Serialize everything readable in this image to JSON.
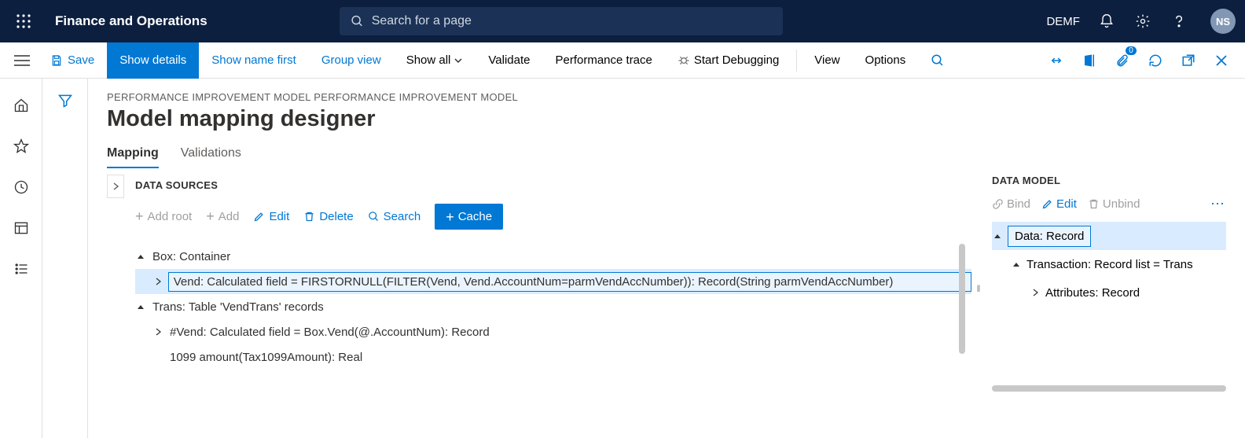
{
  "header": {
    "app_title": "Finance and Operations",
    "search_placeholder": "Search for a page",
    "company": "DEMF",
    "avatar": "NS"
  },
  "action_bar": {
    "save": "Save",
    "show_details": "Show details",
    "show_name_first": "Show name first",
    "group_view": "Group view",
    "show_all": "Show all",
    "validate": "Validate",
    "perf_trace": "Performance trace",
    "start_debug": "Start Debugging",
    "view": "View",
    "options": "Options",
    "badge_count": "0"
  },
  "page": {
    "breadcrumb": "PERFORMANCE IMPROVEMENT MODEL PERFORMANCE IMPROVEMENT MODEL",
    "title": "Model mapping designer",
    "tabs": {
      "mapping": "Mapping",
      "validations": "Validations"
    }
  },
  "data_sources": {
    "title": "DATA SOURCES",
    "toolbar": {
      "add_root": "Add root",
      "add": "Add",
      "edit": "Edit",
      "delete": "Delete",
      "search": "Search",
      "cache": "Cache"
    },
    "tree": {
      "r0": "Box: Container",
      "r1": "Vend: Calculated field = FIRSTORNULL(FILTER(Vend, Vend.AccountNum=parmVendAccNumber)): Record(String parmVendAccNumber)",
      "r2": "Trans: Table 'VendTrans' records",
      "r3": "#Vend: Calculated field = Box.Vend(@.AccountNum): Record",
      "r4": "1099 amount(Tax1099Amount): Real"
    }
  },
  "data_model": {
    "title": "DATA MODEL",
    "toolbar": {
      "bind": "Bind",
      "edit": "Edit",
      "unbind": "Unbind"
    },
    "tree": {
      "r0": "Data: Record",
      "r1": "Transaction: Record list = Trans",
      "r2": "Attributes: Record"
    }
  }
}
